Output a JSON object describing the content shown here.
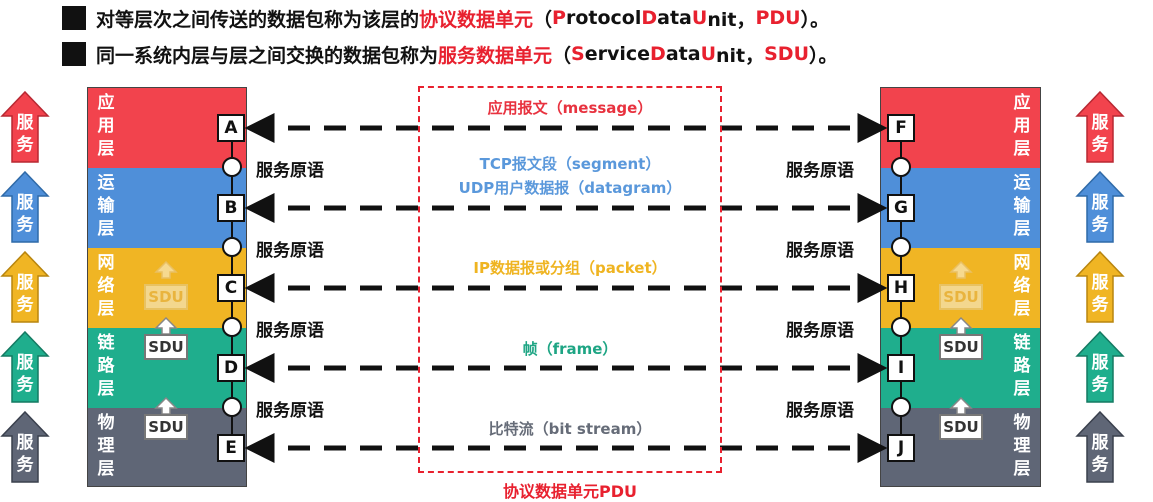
{
  "bullets": {
    "pdu_line": {
      "pre": "对等层次之间传送的数据包称为该层的",
      "term": "协议数据单元",
      "open": "（",
      "en_pre": "",
      "P": "P",
      "p1": "rotocol ",
      "D": "D",
      "p2": "ata ",
      "U": "U",
      "p3": "nit，",
      "abbr": "PDU",
      "close": "）。"
    },
    "sdu_line": {
      "pre": "同一系统内层与层之间交换的数据包称为",
      "term": "服务数据单元",
      "open": "（",
      "S": "S",
      "p1": "ervice ",
      "D": "D",
      "p2": "ata ",
      "U": "U",
      "p3": "nit，",
      "abbr": "SDU",
      "close": "）。"
    }
  },
  "layers": [
    {
      "name": "应用层",
      "chars": [
        "应",
        "用",
        "层"
      ],
      "color": "#f2434d",
      "left_sap": "A",
      "right_sap": "F",
      "pdu": "应用报文（message）",
      "pdu_color": "#e8323f"
    },
    {
      "name": "运输层",
      "chars": [
        "运",
        "输",
        "层"
      ],
      "color": "#4f8fd9",
      "left_sap": "B",
      "right_sap": "G",
      "pdu": "TCP报文段（segment）",
      "pdu2": "UDP用户数据报（datagram）",
      "pdu_color": "#5a98db"
    },
    {
      "name": "网络层",
      "chars": [
        "网",
        "络",
        "层"
      ],
      "color": "#f0b524",
      "left_sap": "C",
      "right_sap": "H",
      "pdu": "IP数据报或分组（packet）",
      "pdu_color": "#efb421"
    },
    {
      "name": "链路层",
      "chars": [
        "链",
        "路",
        "层"
      ],
      "color": "#1fae8d",
      "left_sap": "D",
      "right_sap": "I",
      "pdu": "帧（frame）",
      "pdu_color": "#1ea584"
    },
    {
      "name": "物理层",
      "chars": [
        "物",
        "理",
        "层"
      ],
      "color": "#5f6676",
      "left_sap": "E",
      "right_sap": "J",
      "pdu": "比特流（bit stream）",
      "pdu_color": "#666c78"
    }
  ],
  "primitive_label": "服务原语",
  "sdu_label": "SDU",
  "service_label": [
    "服",
    "务"
  ],
  "pdu_caption": "协议数据单元PDU"
}
